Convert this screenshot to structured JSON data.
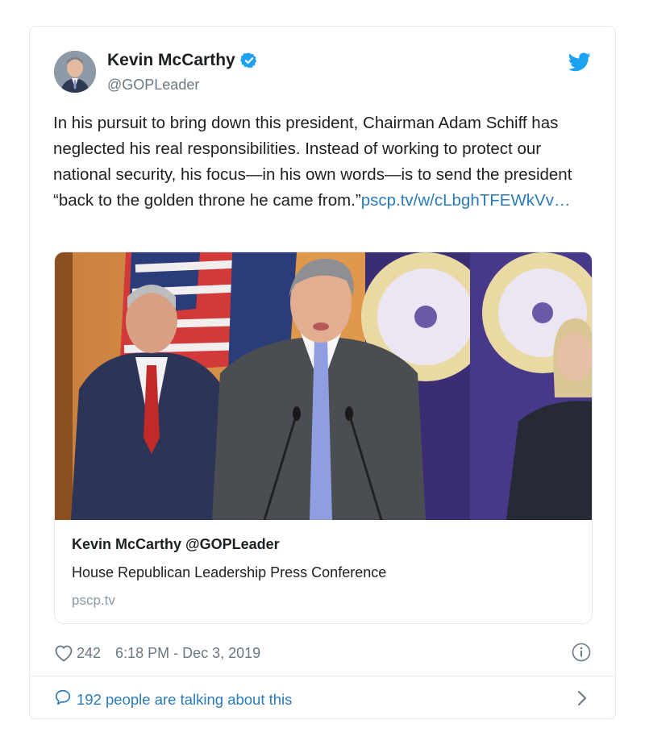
{
  "author": {
    "name": "Kevin McCarthy",
    "handle": "@GOPLeader",
    "verified": true
  },
  "tweet": {
    "text": "In his pursuit to bring down this president, Chairman Adam Schiff has neglected his real responsibilities. Instead of working to protect our national security, his focus—in his own words—is to send the president “back to the golden throne he came from.”",
    "link": "pscp.tv/w/cLbghTFEWkVv…"
  },
  "media_card": {
    "title": "Kevin McCarthy @GOPLeader",
    "description": "House Republican Leadership Press Conference",
    "domain": "pscp.tv"
  },
  "meta": {
    "likes": "242",
    "timestamp": "6:18 PM - Dec 3, 2019"
  },
  "footer": {
    "talking": "192 people are talking about this"
  },
  "icons": {
    "brand": "twitter-bird-icon",
    "verified": "verified-badge-icon",
    "like": "heart-icon",
    "info": "info-icon",
    "reply": "speech-bubble-icon",
    "more": "chevron-right-icon"
  },
  "colors": {
    "link": "#2b7bb9",
    "brand": "#1da1f2",
    "muted": "#697882",
    "border": "#e1e8ed"
  }
}
